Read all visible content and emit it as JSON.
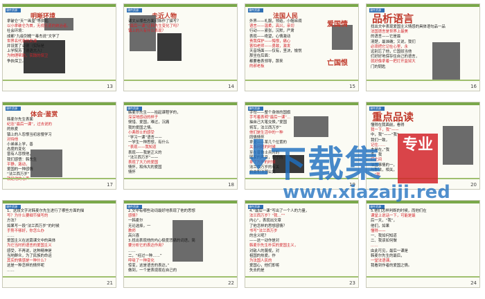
{
  "tab_label": "课件资源",
  "slides": [
    {
      "num": "13",
      "title": "明晰环境",
      "lines": [
        "拿破仑“天”“画皇”等拼贴",
        "以小拿破仑为首，无视无道的统治者。",
        "社会环境：",
        " 成都“九级剑魄”“毒杰说”文学了",
        "世界名代表的民谱",
        "并设置了公德（实际是",
        "上学院苏了德语大人）",
        "为物理帮助，实践的保卫",
        "争执保卫。"
      ]
    },
    {
      "num": "14",
      "title": "走近人物",
      "lines": [
        "课文从哪些方面对韩作了描写？",
        "“最后一课”让韩先生变化了吗？",
        "",
        "",
        "镇上的人有什么表现？"
      ]
    },
    {
      "num": "15",
      "title": "法国人民",
      "side": [
        "爱国情",
        "亡国恨"
      ],
      "lines": [
        "外界——礼服，领结，小帽丝绸",
        "语言——温柔，高兴，亲切",
        "行动——紧张，沉默，严肃",
        "表现——绝望，心情激动",
        "责我保护——悔恨，痛心",
        "",
        "",
        "害怕老师——勇敢，激发",
        "",
        "天音场面——仅有，坚决，愉悦",
        "",
        "那坐在后面：",
        "都要看表领导，那来",
        "的郝老板"
      ]
    },
    {
      "num": "16",
      "title": "品析语言",
      "lines": [
        "找出文中表现爱国主义情感的具体语句品一品",
        "法国语言是世界上最美",
        "的语言——它是最",
        "清楚，最准确；又说，我们",
        "必须把它记在心里，永",
        "远别忘了他，亡国奴当他",
        "们好好地保存住自己的语言，",
        "就好像拿着一把打开监狱大",
        "门的钥匙"
      ]
    },
    {
      "num": "17",
      "title": "体会·鉴赏",
      "lines": [
        "韩麦尔先生表面",
        "纪念“最后一课”，过去说的",
        "的热爱",
        "镇上的人怨恨当初怠慢学习",
        "对待他",
        "小弟弟上学，善",
        "态度的变化",
        "",
        "曾有人怨恨他，",
        "我们感悟：韩先生",
        "平静，激动，",
        "爱国的一种感情",
        "“法兰西万岁”",
        "就是他的心声"
      ]
    },
    {
      "num": "18",
      "title": "",
      "lines": [
        "韩麦尔先生——拾起课程学的，",
        "深深地感动的样子",
        "惋惜、爱国，难过，沉痛",
        "我的爱国之情。",
        "小弗郎士的感受",
        "“学习一课”语言——",
        "一学生一种思想，有什么",
        "“表现——我知道",
        "表现——我是正义的",
        "“法兰西万岁”——",
        "表现了大力的爱国",
        "情怀，和伟大的爱国",
        "情怀"
      ]
    },
    {
      "num": "19",
      "title": "",
      "lines": [
        "字句——整个身体的国旗",
        "手写着表明”最后一课“…",
        "抽自己大笔交换，”爱国",
        "将军，法兰西万岁”",
        "他们是生活中的一种",
        "同情情怀",
        "拿走——某几个位置的",
        "关系问题的时候",
        "至在普鲁士兵时的",
        "国家的声音，即宁的",
        "拿了万岁的时候",
        "法兰西万岁的有关",
        "自由和法国公民…"
      ]
    },
    {
      "num": "20",
      "title": "重点品读",
      "lines": [
        "懂得在我面前，看得",
        "我一下，我”——",
        "中，我”——“我”",
        "我们一致，",
        "记住……",
        "本是在，”我",
        "多，我",
        "们之间",
        "法国事情的一，",
        "与那法，相关，",
        "，“我"
      ]
    },
    {
      "num": "21",
      "title": "",
      "lines": [
        "1、这段文字对韩麦尔先生进行了哪些方面的描",
        "写？为什么要细节描写的",
        "方法？",
        "如果写一段“法兰西万岁”的时候",
        "手势不够好，你怎么办",
        "……",
        "爱国主义在这篇课文中的具体",
        "为它当时的语言的爱国主义",
        "感受，不再说，这种精神是",
        "当地群众，为了民族的命运",
        "其实的情感是一种什么？",
        "这是一种怎样的情怀呢",
        "……"
      ]
    },
    {
      "num": "22",
      "title": "",
      "lines": [
        "2.文中有哪些动词最好地表现了他的思想",
        "感情？",
        "一韩麦尔",
        "无论选择，一",
        "教师",
        "高兴喜",
        "3.找出表现他的内心极度悲痛的词语，简",
        "要分析它的表达作用？",
        "……",
        "二，“经过一种……”",
        "呼吸了一种变化",
        "惊变，这是语言的表达，”",
        "做到，一个是表现现在自己的"
      ]
    },
    {
      "num": "23",
      "title": "",
      "lines": [
        "4.“最后一课”写出了一个人的力量，",
        "法兰西万岁？“我…”“",
        "内心”，表现出文章",
        "了他怎样的思想感情？",
        "书写”法兰西万岁",
        "的含义呢？",
        "——这一动作是对",
        "韩麦尔先生朴实的爱国主义，",
        "对敌人的蔑视，对",
        "祖国的热爱。作",
        "为法国人民的",
        "爱国心，他们即将",
        "失去的是"
      ]
    },
    {
      "num": "24",
      "title": "",
      "lines": [
        "5.他们怎样判断的时候，而他们在",
        "课堂上说话一下，可能是最",
        "后一天，“我”，",
        "他们，如果",
        "懂得——",
        "一、我如何知道",
        "二、我该如何做",
        "……",
        "由此可见，最后一课是",
        "韩麦尔先生的最后，",
        "一堂法语课。",
        "我看到作者的爱国之情。",
        ""
      ]
    }
  ],
  "watermark": {
    "brand": "下载集",
    "stamp": "专业",
    "url": "www.xiazaiji.red"
  }
}
